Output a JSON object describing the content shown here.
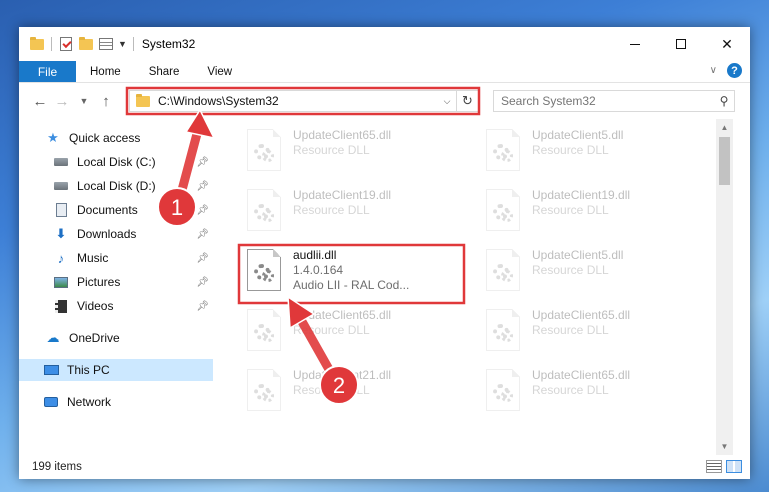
{
  "window": {
    "title": "System32"
  },
  "ribbon": {
    "tabs": [
      "File",
      "Home",
      "Share",
      "View"
    ]
  },
  "address": {
    "path": "C:\\Windows\\System32"
  },
  "search": {
    "placeholder": "Search System32"
  },
  "sidebar": {
    "items": [
      {
        "label": "Quick access",
        "icon": "star-icon",
        "pinned": false
      },
      {
        "label": "Local Disk (C:)",
        "icon": "drive-icon",
        "pinned": true
      },
      {
        "label": "Local Disk (D:)",
        "icon": "drive-icon",
        "pinned": true
      },
      {
        "label": "Documents",
        "icon": "documents-icon",
        "pinned": true
      },
      {
        "label": "Downloads",
        "icon": "downloads-icon",
        "pinned": true
      },
      {
        "label": "Music",
        "icon": "music-icon",
        "pinned": true
      },
      {
        "label": "Pictures",
        "icon": "pictures-icon",
        "pinned": true
      },
      {
        "label": "Videos",
        "icon": "videos-icon",
        "pinned": true
      },
      {
        "label": "OneDrive",
        "icon": "onedrive-icon",
        "pinned": false
      },
      {
        "label": "This PC",
        "icon": "this-pc-icon",
        "pinned": false,
        "selected": true
      },
      {
        "label": "Network",
        "icon": "network-icon",
        "pinned": false
      }
    ]
  },
  "files": [
    {
      "name": "UpdateClient65.dll",
      "type": "Resource DLL",
      "faded": true
    },
    {
      "name": "UpdateClient5.dll",
      "type": "Resource DLL",
      "faded": true
    },
    {
      "name": "UpdateClient19.dll",
      "type": "Resource DLL",
      "faded": true
    },
    {
      "name": "UpdateClient19.dll",
      "type": "Resource DLL",
      "faded": true
    },
    {
      "name": "audlii.dll",
      "version": "1.4.0.164",
      "type": "Audio LII - RAL Cod...",
      "faded": false,
      "highlighted": true
    },
    {
      "name": "UpdateClient5.dll",
      "type": "Resource DLL",
      "faded": true
    },
    {
      "name": "UpdateClient65.dll",
      "type": "Resource DLL",
      "faded": true
    },
    {
      "name": "UpdateClient65.dll",
      "type": "Resource DLL",
      "faded": true
    },
    {
      "name": "UpdateClient21.dll",
      "type": "Resource DLL",
      "faded": true
    },
    {
      "name": "UpdateClient65.dll",
      "type": "Resource DLL",
      "faded": true
    }
  ],
  "status": {
    "item_count": "199 items"
  },
  "annotations": {
    "step1": "1",
    "step2": "2",
    "highlight_color": "#e0383a"
  }
}
